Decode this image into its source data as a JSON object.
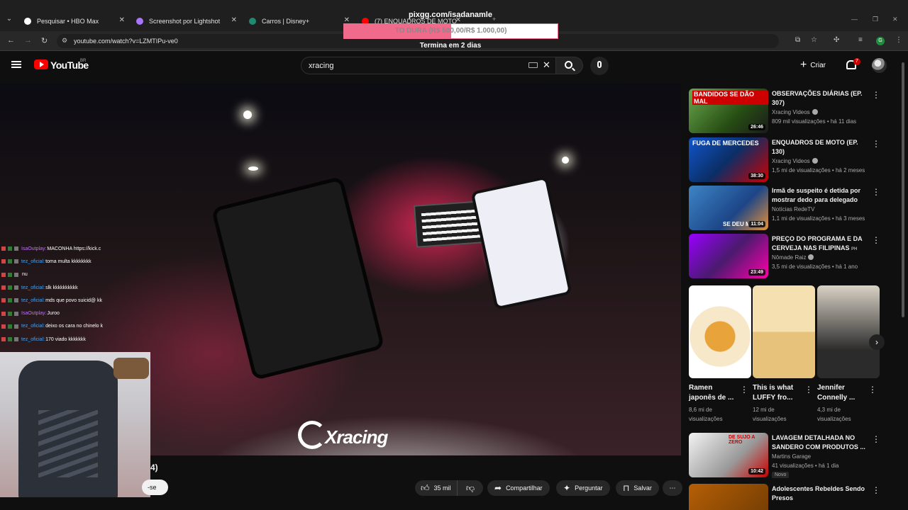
{
  "browser": {
    "tabs": [
      {
        "label": "Pesquisar • HBO Max",
        "color": "#ffffff"
      },
      {
        "label": "Screenshot por Lightshot",
        "color": "#a974ff"
      },
      {
        "label": "Carros | Disney+",
        "color": "#1f8a70"
      },
      {
        "label": "(7) ENQUADROS DE MOTO",
        "color": "#ff0000"
      }
    ],
    "url": "youtube.com/watch?v=LZMTIPu-ve0"
  },
  "overlay": {
    "pix_url": "pixgg.com/isadanamle",
    "goal_text": "TO DURA (R$ 500,00/R$ 1.000,00)",
    "goal_progress": 0.5,
    "goal_sub": "Termina em 2 dias"
  },
  "youtube": {
    "logo_word": "YouTube",
    "region": "BR",
    "search_value": "xracing",
    "create_label": "Criar",
    "notification_count": "7"
  },
  "video": {
    "watermark": "Xracing",
    "title_fragment": "4)",
    "subscribe_fragment": "-se",
    "likes": "35 mil",
    "share_label": "Compartilhar",
    "ask_label": "Perguntar",
    "save_label": "Salvar"
  },
  "chat": [
    {
      "user": "IsaOutplay:",
      "message": "MACONHA https://kick.c",
      "user_color": "#c070ff"
    },
    {
      "user": "tez_oficial:",
      "message": "toma multa kkkkkkkk",
      "user_color": "#3ea6ff"
    },
    {
      "user": "",
      "message": "nu",
      "user_color": "#e05050"
    },
    {
      "user": "tez_oficial:",
      "message": "slk kkkkkkkkkk",
      "user_color": "#3ea6ff"
    },
    {
      "user": "tez_oficial:",
      "message": "mds que povo suicid@ kk",
      "user_color": "#3ea6ff"
    },
    {
      "user": "IsaOutplay:",
      "message": "Juroo",
      "user_color": "#c070ff"
    },
    {
      "user": "tez_oficial:",
      "message": "deixo os cara no chinelo k",
      "user_color": "#3ea6ff"
    },
    {
      "user": "tez_oficial:",
      "message": "170 viado kkkkkkk",
      "user_color": "#3ea6ff"
    }
  ],
  "sidebar": [
    {
      "title": "OBSERVAÇÕES DIÁRIAS (EP. 307)",
      "channel": "Xracing Videos",
      "verified": true,
      "meta": "809 mil visualizações • há 11 dias",
      "duration": "26:46",
      "tag": "BANDIDOS SE DÃO MAL",
      "thumb": "linear-gradient(135deg,#6aa84f,#274e13 60%,#1a1a1a)"
    },
    {
      "title": "ENQUADROS DE MOTO (EP. 130)",
      "channel": "Xracing Videos",
      "verified": true,
      "meta": "1,5 mi de visualizações • há 2 meses",
      "duration": "38:30",
      "tag": "FUGA DE MERCEDES",
      "thumb": "linear-gradient(135deg,#1155cc,#0b2e66 50%,#cc0000)"
    },
    {
      "title": "Irmã de suspeito é detida por mostrar dedo para delegado",
      "channel": "Notícias RedeTV",
      "verified": false,
      "meta": "1,1 mi de visualizações • há 3 meses",
      "duration": "11:04",
      "tag": "SE DEU MAL!",
      "thumb": "linear-gradient(135deg,#3d85c6,#1c4587 60%,#e69138)"
    },
    {
      "title": "PREÇO DO PROGRAMA E DA CERVEJA NAS FILIPINAS",
      "title_suffix": "PH",
      "channel": "Nômade Raiz",
      "verified": true,
      "meta": "3,5 mi de visualizações • há 1 ano",
      "duration": "23:49",
      "tag": "",
      "thumb": "linear-gradient(135deg,#9900ff,#4a1a6e 50%,#ff00aa)"
    },
    {
      "title": "LAVAGEM DETALHADA NO SANDERO COM PRODUTOS ...",
      "channel": "Martins Garage",
      "verified": false,
      "meta": "41 visualizações • há 1 dia",
      "duration": "10:42",
      "tag": "DE SUJO A ZERO",
      "new_badge": "Novo",
      "thumb": "linear-gradient(135deg,#f3f3f3,#999999 60%,#cc0000)"
    },
    {
      "title": "Adolescentes Rebeldes Sendo Presos",
      "channel": "",
      "verified": false,
      "meta": "",
      "duration": "",
      "tag": "",
      "thumb": "linear-gradient(135deg,#b45f06,#783f04)"
    }
  ],
  "shorts": [
    {
      "title": "Ramen japonês de ...",
      "views": "8,6 mi de visualizações",
      "thumb": "radial-gradient(circle at 50% 55%,#e8a33a 0 25%,#f6e8c8 26% 50%,#ffffff 51%)"
    },
    {
      "title": "This is what LUFFY fro...",
      "views": "12 mi de visualizações",
      "thumb": "linear-gradient(180deg,#f4e0b0 0 50%,#e6c27a 50%)"
    },
    {
      "title": "Jennifer Connelly ...",
      "views": "4,3 mi de visualizações",
      "thumb": "linear-gradient(180deg,#d9d2c5,#2b2b2b 70%)"
    }
  ],
  "colors": {
    "yt_red": "#ff0000",
    "goal_pink": "#f06a8c",
    "background": "#0f0f0f"
  }
}
